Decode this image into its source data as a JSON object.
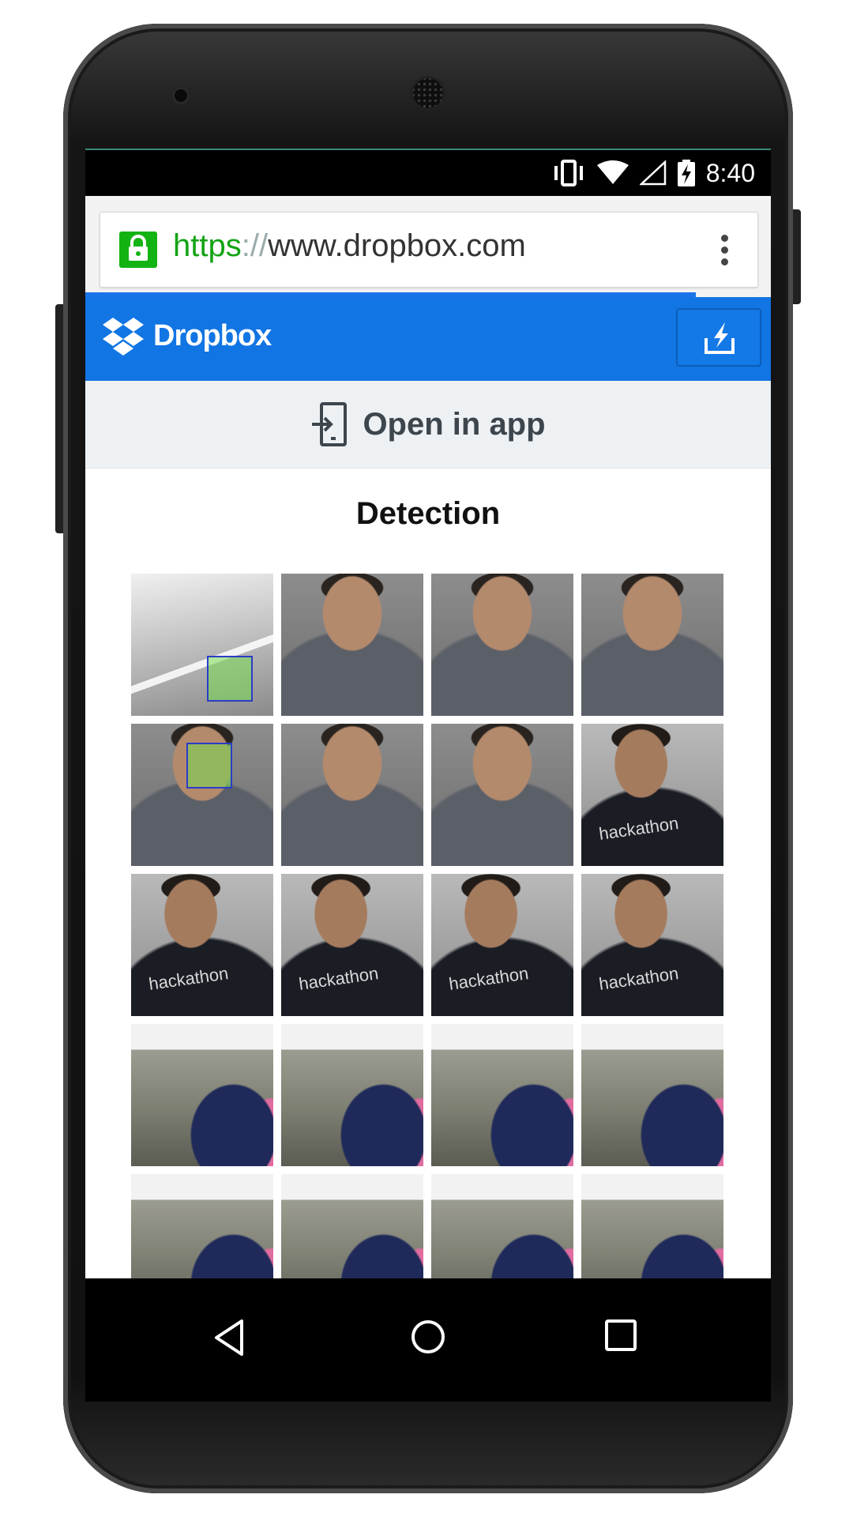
{
  "status_bar": {
    "time": "8:40"
  },
  "browser": {
    "url_scheme": "https",
    "url_separator": "://",
    "url_host": "www.dropbox.com",
    "menu_icon": "overflow-menu-icon",
    "lock_icon": "lock-icon",
    "load_progress": 0.89
  },
  "header": {
    "brand": "Dropbox",
    "download_icon": "download-icon"
  },
  "banner": {
    "open_in_app": "Open in app"
  },
  "folder": {
    "title": "Detection",
    "thumbnails": [
      {
        "kind": "ceiling-face-detected"
      },
      {
        "kind": "person-shirt"
      },
      {
        "kind": "person-shirt"
      },
      {
        "kind": "person-shirt"
      },
      {
        "kind": "person-face-detected"
      },
      {
        "kind": "person-shirt"
      },
      {
        "kind": "person-shirt"
      },
      {
        "kind": "black-shirt",
        "shirt_text": "hackathon"
      },
      {
        "kind": "black-shirt",
        "shirt_text": "hackathon"
      },
      {
        "kind": "black-shirt",
        "shirt_text": "hackathon"
      },
      {
        "kind": "black-shirt",
        "shirt_text": "hackathon"
      },
      {
        "kind": "black-shirt",
        "shirt_text": "hackathon"
      },
      {
        "kind": "room"
      },
      {
        "kind": "room"
      },
      {
        "kind": "room"
      },
      {
        "kind": "room"
      },
      {
        "kind": "room"
      },
      {
        "kind": "room"
      },
      {
        "kind": "room"
      },
      {
        "kind": "room"
      }
    ]
  },
  "colors": {
    "dropbox_blue": "#1175e3",
    "secure_green": "#13b313"
  }
}
